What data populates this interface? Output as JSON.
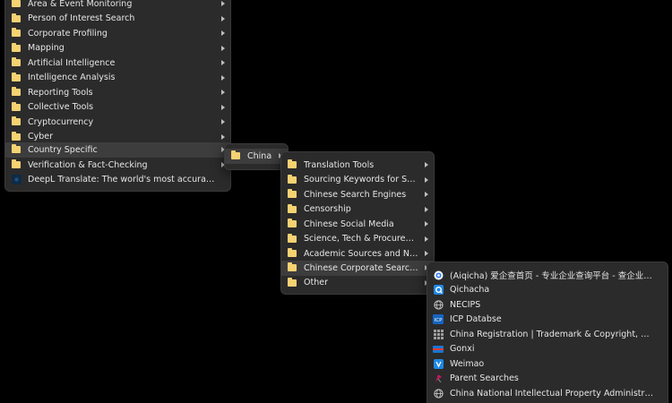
{
  "menu_root": {
    "items": [
      {
        "label": "Area & Event Monitoring",
        "icon": "folder-icon",
        "arrow": true
      },
      {
        "label": "Person of Interest Search",
        "icon": "folder-icon",
        "arrow": true
      },
      {
        "label": "Corporate Profiling",
        "icon": "folder-icon",
        "arrow": true
      },
      {
        "label": "Mapping",
        "icon": "folder-icon",
        "arrow": true
      },
      {
        "label": "Artificial Intelligence",
        "icon": "folder-icon",
        "arrow": true
      },
      {
        "label": "Intelligence Analysis",
        "icon": "folder-icon",
        "arrow": true
      },
      {
        "label": "Reporting Tools",
        "icon": "folder-icon",
        "arrow": true
      },
      {
        "label": "Collective Tools",
        "icon": "folder-icon",
        "arrow": true
      },
      {
        "label": "Cryptocurrency",
        "icon": "folder-icon",
        "arrow": true
      },
      {
        "label": "Cyber",
        "icon": "folder-icon",
        "arrow": true
      },
      {
        "label": "Country Specific",
        "icon": "folder-icon",
        "arrow": true,
        "active": true
      },
      {
        "label": "Verification & Fact-Checking",
        "icon": "folder-icon",
        "arrow": true
      },
      {
        "label": "DeepL Translate: The world's most accurate tran...",
        "icon": "deepl-icon",
        "arrow": false
      }
    ]
  },
  "menu_country": {
    "items": [
      {
        "label": "China",
        "icon": "folder-icon",
        "arrow": true,
        "active": true
      }
    ]
  },
  "menu_china": {
    "items": [
      {
        "label": "Translation Tools",
        "icon": "folder-icon",
        "arrow": true
      },
      {
        "label": "Sourcing Keywords for Search",
        "icon": "folder-icon",
        "arrow": true
      },
      {
        "label": "Chinese Search Engines",
        "icon": "folder-icon",
        "arrow": true
      },
      {
        "label": "Censorship",
        "icon": "folder-icon",
        "arrow": true
      },
      {
        "label": "Chinese Social Media",
        "icon": "folder-icon",
        "arrow": true
      },
      {
        "label": "Science, Tech & Procurement",
        "icon": "folder-icon",
        "arrow": true
      },
      {
        "label": "Academic Sources and News",
        "icon": "folder-icon",
        "arrow": true
      },
      {
        "label": "Chinese Corporate Searches",
        "icon": "folder-icon",
        "arrow": true,
        "active": true
      },
      {
        "label": "Other",
        "icon": "folder-icon",
        "arrow": true
      }
    ]
  },
  "menu_corporate": {
    "items": [
      {
        "label": "(Aiqicha) 爱企查首页 - 专业企业查询平台 - 查企业 - 查...",
        "icon": "aiqicha-icon"
      },
      {
        "label": "Qichacha",
        "icon": "qichacha-icon"
      },
      {
        "label": "NECIPS",
        "icon": "globe-icon"
      },
      {
        "label": "ICP Databse",
        "icon": "icp-icon"
      },
      {
        "label": "China  Registration | Trademark & Copyright, Paten...",
        "icon": "grid-icon"
      },
      {
        "label": "Gonxi",
        "icon": "gonxi-icon"
      },
      {
        "label": "Weimao",
        "icon": "weimao-icon"
      },
      {
        "label": "Parent Searches",
        "icon": "parent-icon"
      },
      {
        "label": "China National Intellectual Property Administration",
        "icon": "globe-icon"
      }
    ]
  },
  "colors": {
    "menu_bg": "#2b2b2b",
    "menu_border": "#3a3a3a",
    "active_bg": "#3d3d3d",
    "text": "#e6e6e6",
    "folder": "#f5d272"
  }
}
